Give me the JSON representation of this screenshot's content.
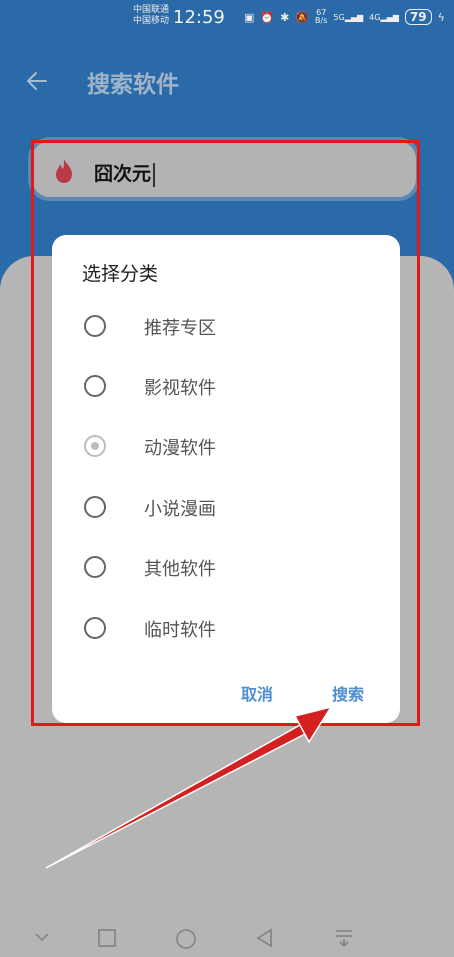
{
  "status_bar": {
    "carrier1": "中国联通",
    "carrier2": "中国移动",
    "time": "12:59",
    "speed_top": "67",
    "speed_bottom": "B/s",
    "sig1": "5G",
    "sig2": "4G",
    "battery": "79"
  },
  "appbar": {
    "title": "搜索软件"
  },
  "search": {
    "query": "囧次元"
  },
  "dialog": {
    "title": "选择分类",
    "options": [
      {
        "label": "推荐专区",
        "selected": false
      },
      {
        "label": "影视软件",
        "selected": false
      },
      {
        "label": "动漫软件",
        "selected": true
      },
      {
        "label": "小说漫画",
        "selected": false
      },
      {
        "label": "其他软件",
        "selected": false
      },
      {
        "label": "临时软件",
        "selected": false
      }
    ],
    "cancel_label": "取消",
    "search_label": "搜索"
  },
  "colors": {
    "header": "#2b6aa8",
    "accent": "#4e8fd0",
    "highlight": "#e01a1a"
  }
}
